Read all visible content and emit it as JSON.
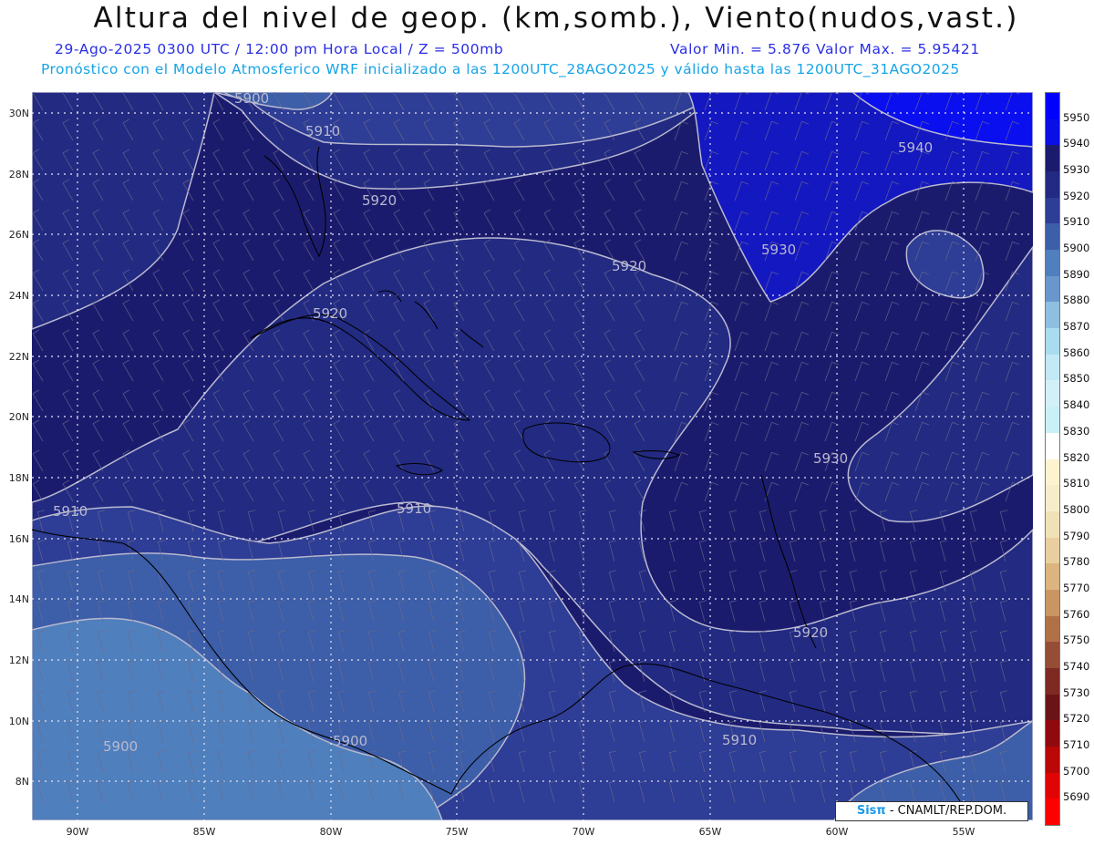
{
  "header": {
    "title": "Altura del nivel de geop. (km,somb.), Viento(nudos,vast.)",
    "valid_line": "29-Ago-2025  0300 UTC / 12:00 pm Hora Local / Z = 500mb",
    "min_max": "Valor Min. = 5.876  Valor Max. = 5.95421",
    "model_line": "Pronóstico con el Modelo Atmosferico WRF inicializado a las 1200UTC_28AGO2025 y válido hasta las  1200UTC_31AGO2025"
  },
  "map": {
    "lat_labels": [
      "30N",
      "28N",
      "26N",
      "24N",
      "22N",
      "20N",
      "18N",
      "16N",
      "14N",
      "12N",
      "10N",
      "8N"
    ],
    "lon_labels": [
      "90W",
      "85W",
      "80W",
      "75W",
      "70W",
      "65W",
      "60W",
      "55W"
    ],
    "contour_labels": [
      "5900",
      "5910",
      "5920",
      "5920",
      "5920",
      "5930",
      "5940",
      "5930",
      "5910",
      "5910",
      "5920",
      "5900",
      "5910",
      "5900"
    ],
    "fill_colors": {
      "5890": "#4f7fbd",
      "5900": "#3d5ea8",
      "5910": "#2e3d95",
      "5920": "#222a82",
      "5930": "#1b1b6e",
      "5940": "#1418c0",
      "5950": "#0a0ff0"
    },
    "contour_color": "#b9b9cf",
    "barb_color": "#6c6c8e",
    "coast_color": "#000000"
  },
  "colorbar": {
    "labels": [
      "5950",
      "5940",
      "5930",
      "5920",
      "5910",
      "5900",
      "5890",
      "5880",
      "5870",
      "5860",
      "5850",
      "5840",
      "5830",
      "5820",
      "5810",
      "5800",
      "5790",
      "5780",
      "5770",
      "5760",
      "5750",
      "5740",
      "5730",
      "5720",
      "5710",
      "5700",
      "5690"
    ],
    "colors": [
      "#0000ff",
      "#0a0fe6",
      "#1b1b6e",
      "#222a82",
      "#2e3d95",
      "#3d5ea8",
      "#4f7fbd",
      "#6996cb",
      "#8ebfe0",
      "#aadcef",
      "#c2e9f5",
      "#d3f0f8",
      "#c9f0f6",
      "#ffffff",
      "#fdf4cf",
      "#f8edca",
      "#f1e1b8",
      "#e9cf9f",
      "#dcb47f",
      "#c89563",
      "#b07048",
      "#964d35",
      "#7d2a22",
      "#6a1418",
      "#8f0a0e",
      "#b80808",
      "#e00404",
      "#ff0000"
    ]
  },
  "credit": {
    "logo": "Sisπ",
    "text": "- CNAMLT/REP.DOM."
  }
}
